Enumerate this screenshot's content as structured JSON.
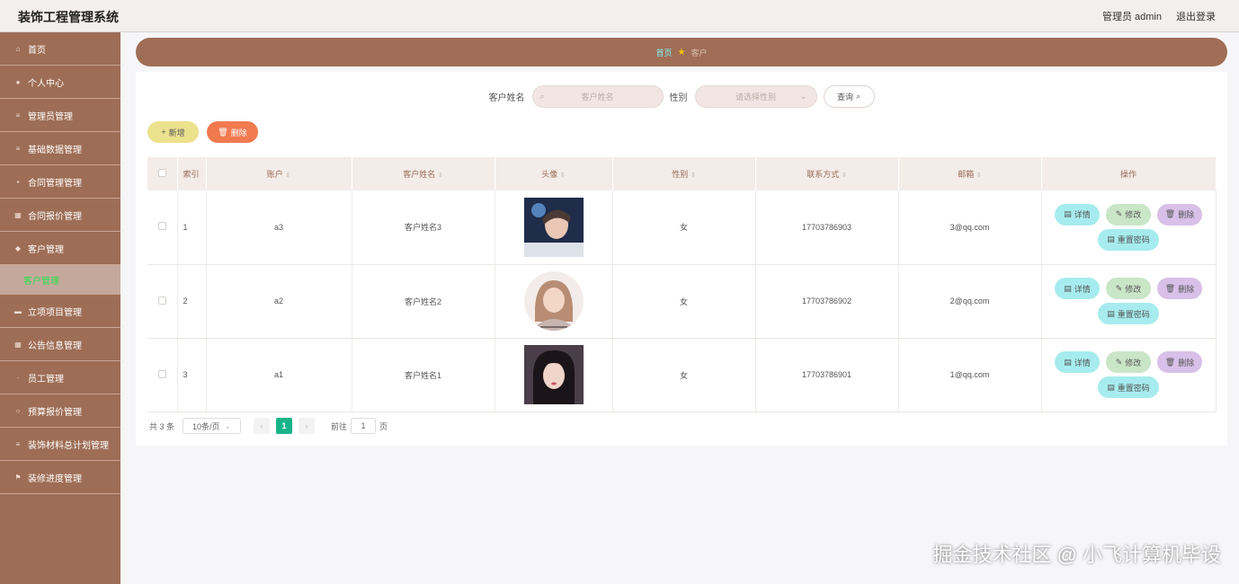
{
  "app": {
    "title": "装饰工程管理系统"
  },
  "header": {
    "user": "管理员 admin",
    "logout": "退出登录"
  },
  "sidebar": {
    "items": [
      {
        "label": "首页",
        "icon": "home-icon",
        "glyph": "⌂"
      },
      {
        "label": "个人中心",
        "icon": "user-icon",
        "glyph": "●"
      },
      {
        "label": "管理员管理",
        "icon": "list-icon",
        "glyph": "≡"
      },
      {
        "label": "基础数据管理",
        "icon": "list-icon",
        "glyph": "≡"
      },
      {
        "label": "合同管理管理",
        "icon": "chart-icon",
        "glyph": "▪"
      },
      {
        "label": "合同报价管理",
        "icon": "grid-icon",
        "glyph": "▦"
      },
      {
        "label": "客户管理",
        "icon": "pin-icon",
        "glyph": "◆"
      }
    ],
    "sub_item": "客户管理",
    "items_after": [
      {
        "label": "立项项目管理",
        "icon": "folder-icon",
        "glyph": "▬"
      },
      {
        "label": "公告信息管理",
        "icon": "grid-icon",
        "glyph": "▦"
      },
      {
        "label": "员工管理",
        "icon": "staff-icon",
        "glyph": "·"
      },
      {
        "label": "预算报价管理",
        "icon": "circle-icon",
        "glyph": "○"
      },
      {
        "label": "装饰材料总计划管理",
        "icon": "list-icon",
        "glyph": "≡"
      },
      {
        "label": "装修进度管理",
        "icon": "flag-icon",
        "glyph": "⚑"
      }
    ]
  },
  "breadcrumb": {
    "home": "首页",
    "current": "客户"
  },
  "search": {
    "name_label": "客户姓名",
    "name_placeholder": "客户姓名",
    "gender_label": "性别",
    "gender_placeholder": "请选择性别",
    "query_label": "查询"
  },
  "toolbar": {
    "add_label": "新增",
    "delete_label": "删除"
  },
  "table": {
    "headers": [
      "索引",
      "账户",
      "客户姓名",
      "头像",
      "性别",
      "联系方式",
      "邮箱",
      "操作"
    ],
    "rows": [
      {
        "index": "1",
        "account": "a3",
        "name": "客户姓名3",
        "avatar": "male-portrait",
        "gender": "女",
        "phone": "17703786903",
        "email": "3@qq.com"
      },
      {
        "index": "2",
        "account": "a2",
        "name": "客户姓名2",
        "avatar": "female-portrait-round",
        "gender": "女",
        "phone": "17703786902",
        "email": "2@qq.com"
      },
      {
        "index": "3",
        "account": "a1",
        "name": "客户姓名1",
        "avatar": "female-portrait",
        "gender": "女",
        "phone": "17703786901",
        "email": "1@qq.com"
      }
    ],
    "actions": {
      "detail": "详情",
      "edit": "修改",
      "delete": "删除",
      "reset": "重置密码"
    }
  },
  "pagination": {
    "total": "共 3 条",
    "page_size": "10条/页",
    "current_page": "1",
    "goto_prefix": "前往",
    "goto_value": "1",
    "goto_suffix": "页"
  },
  "watermark": "掘金技术社区 @ 小飞计算机毕设",
  "colors": {
    "sidebar": "#9e6d55",
    "breadcrumb": "#a06e56",
    "accent": "#19b38a"
  }
}
